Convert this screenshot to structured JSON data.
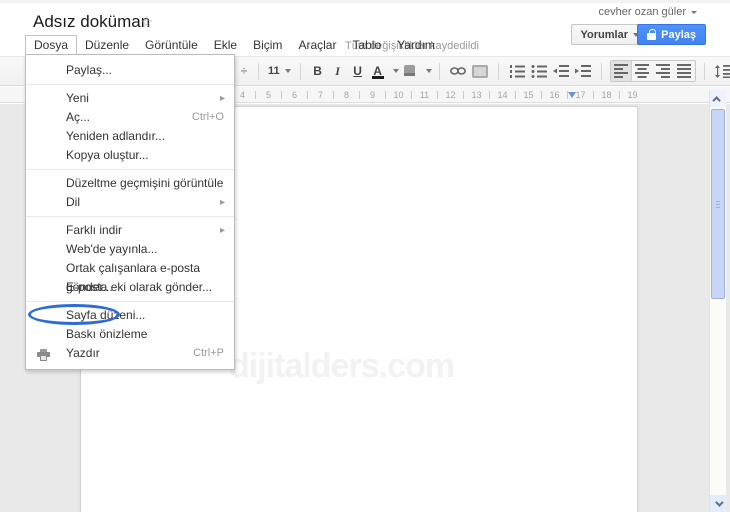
{
  "header": {
    "title": "Adsız doküman",
    "star_glyph": "☆",
    "saved_status": "Tüm değişiklikler kaydedildi",
    "comments_label": "Yorumlar",
    "share_label": "Paylaş"
  },
  "account": {
    "name": "cevher ozan güler"
  },
  "menubar": {
    "items": [
      "Dosya",
      "Düzenle",
      "Görüntüle",
      "Ekle",
      "Biçim",
      "Araçlar",
      "Tablo",
      "Yardım"
    ],
    "names": [
      "dosya",
      "duzenle",
      "goruntule",
      "ekle",
      "bicim",
      "araclar",
      "tablo",
      "yardim"
    ],
    "active": "Dosya"
  },
  "file_menu": {
    "items": [
      {
        "name": "paylas",
        "label": "Paylaş..."
      },
      {
        "type": "separator"
      },
      {
        "name": "yeni",
        "label": "Yeni",
        "submenu": true
      },
      {
        "name": "ac",
        "label": "Aç...",
        "shortcut": "Ctrl+O"
      },
      {
        "name": "yeniden-adlandir",
        "label": "Yeniden adlandır..."
      },
      {
        "name": "kopya-olustur",
        "label": "Kopya oluştur..."
      },
      {
        "type": "separator"
      },
      {
        "name": "duzeltme-gecmisini-goruntule",
        "label": "Düzeltme geçmişini görüntüle"
      },
      {
        "name": "dil",
        "label": "Dil",
        "submenu": true
      },
      {
        "type": "separator"
      },
      {
        "name": "farkli-indir",
        "label": "Farklı indir",
        "submenu": true
      },
      {
        "name": "webde-yayinla",
        "label": "Web'de yayınla..."
      },
      {
        "name": "ortak-calisanlara-eposta-gonder",
        "label": "Ortak çalışanlara e-posta gönder..."
      },
      {
        "name": "eposta-eki-olarak-gonder",
        "label": "E-posta eki olarak gönder..."
      },
      {
        "type": "separator"
      },
      {
        "name": "sayfa-duzeni",
        "label": "Sayfa düzeni...",
        "annotated": true
      },
      {
        "name": "baski-onizleme",
        "label": "Baskı önizleme"
      },
      {
        "name": "yazdir",
        "label": "Yazdır",
        "shortcut": "Ctrl+P",
        "icon": "printer-icon"
      }
    ]
  },
  "toolbar": {
    "spinner_glyph": "÷",
    "font_size": "11",
    "bold_label": "B",
    "italic_label": "I",
    "underline_label": "U",
    "text_color_label": "A",
    "icons": [
      "text-color-icon",
      "highlight-color-icon",
      "link-icon",
      "image-icon",
      "numbered-list-icon",
      "bulleted-list-icon",
      "outdent-icon",
      "indent-icon",
      "align-left-icon",
      "align-center-icon",
      "align-right-icon",
      "justify-icon",
      "line-spacing-icon"
    ]
  },
  "ruler": {
    "numbers": [
      "4",
      "5",
      "6",
      "7",
      "8",
      "9",
      "10",
      "11",
      "12",
      "13",
      "14",
      "15",
      "16",
      "17",
      "18",
      "19"
    ]
  },
  "page": {
    "watermark": "dijitalders.com"
  },
  "colors": {
    "share_button_blue": "#4d90fe",
    "annotation_ellipse_blue": "#2e6bd4",
    "canvas_gray": "#e9e9e9",
    "scrollbar_thumb": "#c7d5f7",
    "saved_status_gray": "#9a9a9a"
  }
}
